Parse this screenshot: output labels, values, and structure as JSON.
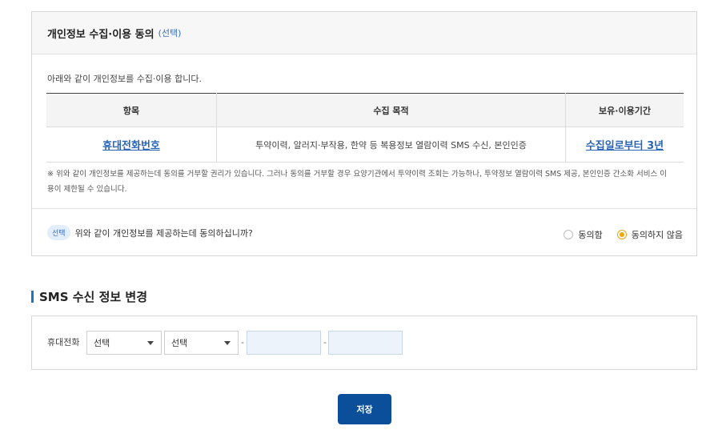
{
  "consent": {
    "title": "개인정보 수집·이용 동의",
    "badge": "(선택)",
    "intro": "아래와 같이 개인정보를 수집·이용 합니다.",
    "table": {
      "headers": [
        "항목",
        "수집 목적",
        "보유·이용기간"
      ],
      "row": [
        "휴대전화번호",
        "투약이력, 알러지·부작용, 한약 등 복용정보 열람이력 SMS 수신, 본인인증",
        "수집일로부터 3년"
      ]
    },
    "notice": "※ 위와 같이 개인정보를 제공하는데 동의를 거부할 권리가 있습니다. 그러나 동의를 거부할 경우 요양기관에서 투약이력 조회는 가능하나, 투약정보 열람이력 SMS 제공, 본인인증 간소화 서비스 이용이 제한될 수 있습니다.",
    "question_badge": "선택",
    "question": "위와 같이 개인정보를 제공하는데 동의하십니까?",
    "options": [
      {
        "label": "동의함",
        "checked": false
      },
      {
        "label": "동의하지 않음",
        "checked": true
      }
    ]
  },
  "sms": {
    "title": "SMS 수신 정보 변경",
    "phone_label": "휴대전화",
    "select1": "선택",
    "select2": "선택",
    "dash": "-",
    "input2_value": "",
    "input3_value": ""
  },
  "save_label": "저장",
  "colors": {
    "primary": "#0b4f9b",
    "accent_bar": "#1a73c9",
    "link": "#2a66b8",
    "radio_checked": "#f0a500"
  }
}
